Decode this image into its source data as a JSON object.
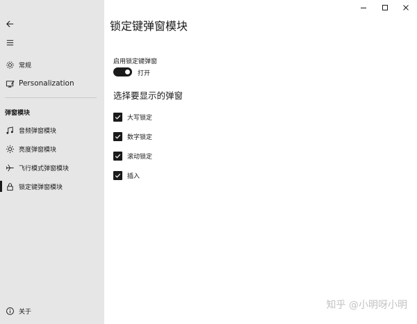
{
  "window": {
    "controls": [
      {
        "icon": "minimize-icon"
      },
      {
        "icon": "maximize-icon"
      },
      {
        "icon": "close-icon"
      }
    ]
  },
  "sidebar": {
    "top_items": [
      {
        "label": "常规",
        "icon": "gear-icon"
      },
      {
        "label": "Personalization",
        "icon": "personalization-icon"
      }
    ],
    "section_title": "弹窗模块",
    "module_items": [
      {
        "label": "音频弹窗模块",
        "icon": "music-note-icon"
      },
      {
        "label": "亮度弹窗模块",
        "icon": "brightness-icon"
      },
      {
        "label": "飞行模式弹窗模块",
        "icon": "airplane-icon"
      },
      {
        "label": "锁定键弹窗模块",
        "icon": "lock-icon",
        "selected": true
      }
    ],
    "bottom_item": {
      "label": "关于",
      "icon": "info-icon"
    }
  },
  "main": {
    "title": "锁定键弹窗模块",
    "toggle": {
      "label": "启用锁定键弹窗",
      "state_text": "打开",
      "on": true
    },
    "section_heading": "选择要显示的弹窗",
    "checkboxes": [
      {
        "label": "大写锁定",
        "checked": true
      },
      {
        "label": "数字锁定",
        "checked": true
      },
      {
        "label": "滚动锁定",
        "checked": true
      },
      {
        "label": "插入",
        "checked": true
      }
    ]
  },
  "watermark": "知乎 @小明呀小明",
  "colors": {
    "sidebar_bg": "#e6e6e6",
    "main_bg": "#ffffff",
    "accent": "#1a1a1a",
    "watermark": "#c2c2c2"
  }
}
